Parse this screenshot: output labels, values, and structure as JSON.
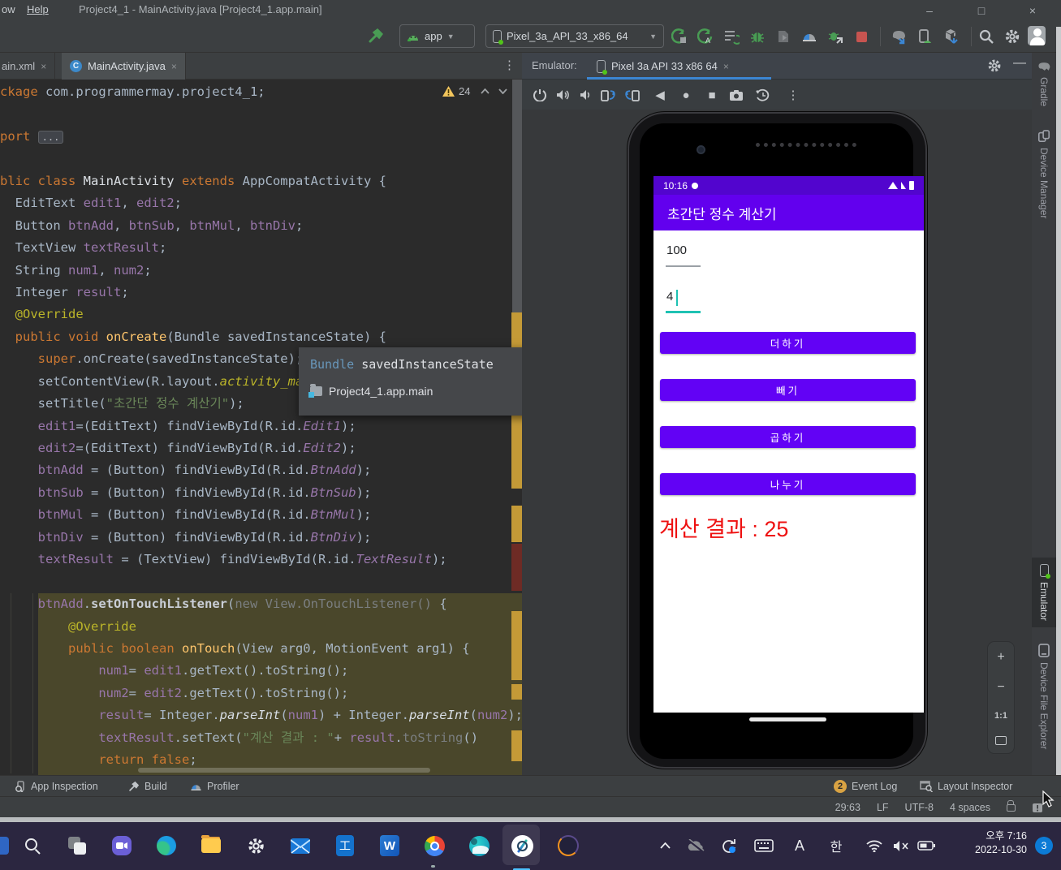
{
  "colors": {
    "app_primary": "#6200EE",
    "phone_status_bar": "#5205CE",
    "accent_teal": "#1FC2B3",
    "result_red": "#EE1111",
    "tab_underline": "#3B86D3",
    "warning_stripe": "#C49A37",
    "selection_olive": "#4A472B",
    "taskbar_bg": "#2B2640"
  },
  "title_bar": {
    "menu_window_partial": "ow",
    "menu_help": "Help",
    "title": "Project4_1 - MainActivity.java [Project4_1.app.main]",
    "minimize": "–",
    "maximize": "□",
    "close": "×"
  },
  "toolbar": {
    "run_config": "app",
    "device": "Pixel_3a_API_33_x86_64"
  },
  "editor_tabs": {
    "tab1": "ain.xml",
    "tab2": "MainActivity.java",
    "close": "×",
    "kebab": "⋮"
  },
  "editor": {
    "warning_count": "24",
    "lines": [
      [
        [
          "kw",
          "ckage"
        ],
        [
          "pl",
          " com.programmermay.project4_1;"
        ]
      ],
      [],
      [
        [
          "kw",
          "port "
        ],
        [
          "fold",
          "..."
        ]
      ],
      [],
      [
        [
          "kw",
          "blic class"
        ],
        [
          "white",
          " MainActivity "
        ],
        [
          "kw",
          "extends"
        ],
        [
          "pl",
          " AppCompatActivity {"
        ]
      ],
      [
        [
          "pl",
          "  EditText "
        ],
        [
          "fld",
          "edit1"
        ],
        [
          "pl",
          ", "
        ],
        [
          "fld",
          "edit2"
        ],
        [
          "pl",
          ";"
        ]
      ],
      [
        [
          "pl",
          "  Button "
        ],
        [
          "fld",
          "btnAdd"
        ],
        [
          "pl",
          ", "
        ],
        [
          "fld",
          "btnSub"
        ],
        [
          "pl",
          ", "
        ],
        [
          "fld",
          "btnMul"
        ],
        [
          "pl",
          ", "
        ],
        [
          "fld",
          "btnDiv"
        ],
        [
          "pl",
          ";"
        ]
      ],
      [
        [
          "pl",
          "  TextView "
        ],
        [
          "fld",
          "textResult"
        ],
        [
          "pl",
          ";"
        ]
      ],
      [
        [
          "pl",
          "  String "
        ],
        [
          "fld",
          "num1"
        ],
        [
          "pl",
          ", "
        ],
        [
          "fld",
          "num2"
        ],
        [
          "pl",
          ";"
        ]
      ],
      [
        [
          "pl",
          "  Integer "
        ],
        [
          "fld",
          "result"
        ],
        [
          "pl",
          ";"
        ]
      ],
      [
        [
          "ann",
          "  @Override"
        ]
      ],
      [
        [
          "pl",
          "  "
        ],
        [
          "kw",
          "public void "
        ],
        [
          "meth",
          "onCreate"
        ],
        [
          "pl",
          "(Bundle savedInstanceState) {"
        ]
      ],
      [
        [
          "pl",
          "     "
        ],
        [
          "kw",
          "super"
        ],
        [
          "pl",
          ".onCreate(savedInstanceState);"
        ]
      ],
      [
        [
          "pl",
          "     setContentView(R.layout."
        ],
        [
          "iann",
          "activity_main"
        ],
        [
          "pl",
          ");"
        ]
      ],
      [
        [
          "pl",
          "     setTitle("
        ],
        [
          "str",
          "\"초간단 정수 계산기\""
        ],
        [
          "pl",
          ");"
        ]
      ],
      [
        [
          "pl",
          "     "
        ],
        [
          "fld",
          "edit1"
        ],
        [
          "pl",
          "=(EditText) findViewById(R.id."
        ],
        [
          "ifld",
          "Edit1"
        ],
        [
          "pl",
          ");"
        ]
      ],
      [
        [
          "pl",
          "     "
        ],
        [
          "fld",
          "edit2"
        ],
        [
          "pl",
          "=(EditText) findViewById(R.id."
        ],
        [
          "ifld",
          "Edit2"
        ],
        [
          "pl",
          ");"
        ]
      ],
      [
        [
          "pl",
          "     "
        ],
        [
          "fld",
          "btnAdd"
        ],
        [
          "pl",
          " = (Button) findViewById(R.id."
        ],
        [
          "ifld",
          "BtnAdd"
        ],
        [
          "pl",
          ");"
        ]
      ],
      [
        [
          "pl",
          "     "
        ],
        [
          "fld",
          "btnSub"
        ],
        [
          "pl",
          " = (Button) findViewById(R.id."
        ],
        [
          "ifld",
          "BtnSub"
        ],
        [
          "pl",
          ");"
        ]
      ],
      [
        [
          "pl",
          "     "
        ],
        [
          "fld",
          "btnMul"
        ],
        [
          "pl",
          " = (Button) findViewById(R.id."
        ],
        [
          "ifld",
          "BtnMul"
        ],
        [
          "pl",
          ");"
        ]
      ],
      [
        [
          "pl",
          "     "
        ],
        [
          "fld",
          "btnDiv"
        ],
        [
          "pl",
          " = (Button) findViewById(R.id."
        ],
        [
          "ifld",
          "BtnDiv"
        ],
        [
          "pl",
          ");"
        ]
      ],
      [
        [
          "pl",
          "     "
        ],
        [
          "fld",
          "textResult"
        ],
        [
          "pl",
          " = (TextView) findViewById(R.id."
        ],
        [
          "ifld",
          "TextResult"
        ],
        [
          "pl",
          ");"
        ]
      ],
      [],
      [
        [
          "pl",
          "     "
        ],
        [
          "fld",
          "btnAdd"
        ],
        [
          "pl",
          "."
        ],
        [
          "bold",
          "setOnTouchListener"
        ],
        [
          "pl",
          "("
        ],
        [
          "gray",
          "new View.OnTouchListener() "
        ],
        [
          "pl",
          "{"
        ]
      ],
      [
        [
          "ann",
          "         @Override"
        ]
      ],
      [
        [
          "pl",
          "         "
        ],
        [
          "kw",
          "public boolean "
        ],
        [
          "meth",
          "onTouch"
        ],
        [
          "pl",
          "(View arg0, MotionEvent arg1) {"
        ]
      ],
      [
        [
          "pl",
          "             "
        ],
        [
          "fld",
          "num1"
        ],
        [
          "pl",
          "= "
        ],
        [
          "fld",
          "edit1"
        ],
        [
          "pl",
          ".getText().toString();"
        ]
      ],
      [
        [
          "pl",
          "             "
        ],
        [
          "fld",
          "num2"
        ],
        [
          "pl",
          "= "
        ],
        [
          "fld",
          "edit2"
        ],
        [
          "pl",
          ".getText().toString();"
        ]
      ],
      [
        [
          "pl",
          "             "
        ],
        [
          "fld",
          "result"
        ],
        [
          "pl",
          "= Integer."
        ],
        [
          "imeth",
          "parseInt"
        ],
        [
          "pl",
          "("
        ],
        [
          "fld",
          "num1"
        ],
        [
          "pl",
          ") + Integer."
        ],
        [
          "imeth",
          "parseInt"
        ],
        [
          "pl",
          "("
        ],
        [
          "fld",
          "num2"
        ],
        [
          "pl",
          ");"
        ]
      ],
      [
        [
          "pl",
          "             "
        ],
        [
          "fld",
          "textResult"
        ],
        [
          "pl",
          ".setText("
        ],
        [
          "str",
          "\"계산 결과 : \""
        ],
        [
          "pl",
          "+ "
        ],
        [
          "fld",
          "result"
        ],
        [
          "pl",
          "."
        ],
        [
          "gray",
          "toString"
        ],
        [
          "pl",
          "()"
        ]
      ],
      [
        [
          "pl",
          "             "
        ],
        [
          "kw",
          "return false"
        ],
        [
          "pl",
          ";"
        ]
      ]
    ]
  },
  "popup": {
    "type_name": "Bundle",
    "var_name": " savedInstanceState",
    "module": "Project4_1.app.main",
    "kebab": "⋮"
  },
  "emulator": {
    "panel_label": "Emulator:",
    "tab_label": "Pixel 3a API 33 x86 64",
    "close": "×",
    "phone": {
      "status_time": "10:16",
      "app_title": "초간단 정수 계산기",
      "input1": "100",
      "input2": "4",
      "buttons": [
        "더하기",
        "빼기",
        "곱하기",
        "나누기"
      ],
      "result": "계산 결과 : 25"
    }
  },
  "right_stripe": {
    "items": [
      "Gradle",
      "Device Manager",
      "Emulator",
      "Device File Explorer"
    ],
    "zoom_in": "+",
    "zoom_out": "−",
    "zoom_reset": "1:1"
  },
  "bottom_bar": {
    "app_inspection": "App Inspection",
    "build": "Build",
    "profiler": "Profiler",
    "event_count": "2",
    "event_log": "Event Log",
    "layout_inspector": "Layout Inspector"
  },
  "status_bar": {
    "position": "29:63",
    "line_sep": "LF",
    "encoding": "UTF-8",
    "indent": "4 spaces"
  },
  "taskbar": {
    "word_label": "W",
    "hwp_label": "工",
    "ime_en": "A",
    "ime_ko": "한",
    "time": "오후 7:16",
    "date": "2022-10-30",
    "badge": "3"
  }
}
